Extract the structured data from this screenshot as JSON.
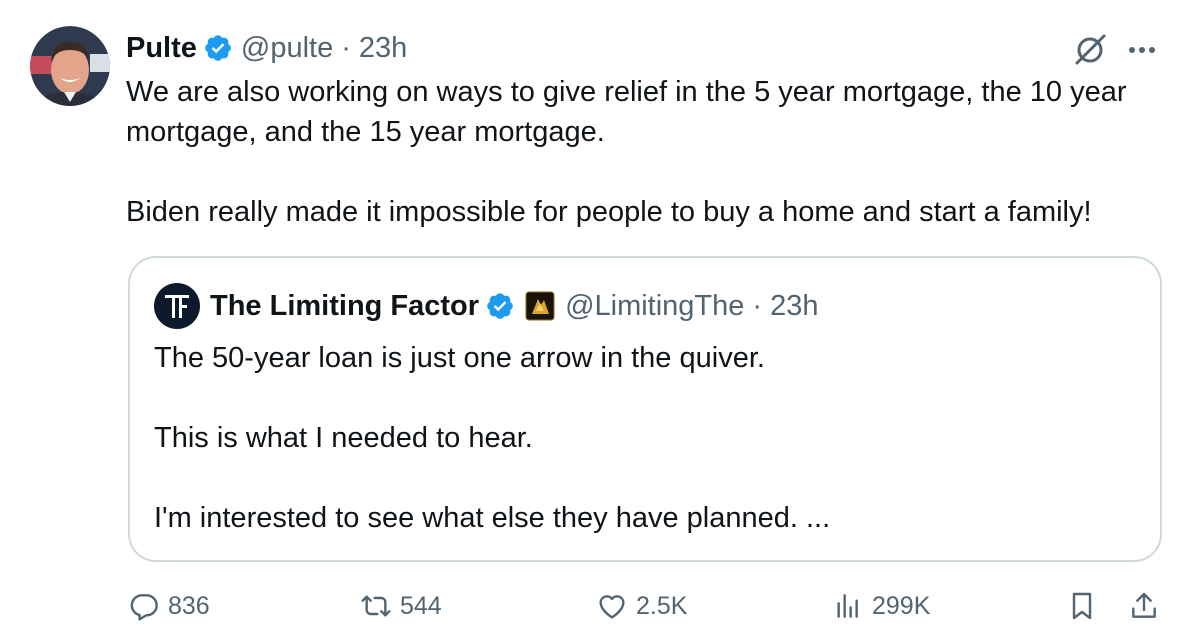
{
  "tweet": {
    "author": {
      "name": "Pulte",
      "handle": "@pulte",
      "time": "23h",
      "separator": "·"
    },
    "paragraphs": [
      "We are also working on ways to give relief in the 5 year mortgage, the 10 year mortgage, and the 15 year mortgage.",
      "Biden really made it impossible for people to buy a home and start a family!"
    ]
  },
  "quote": {
    "author": {
      "name": "The Limiting Factor",
      "handle": "@LimitingThe",
      "time": "23h",
      "separator": "·"
    },
    "paragraphs": [
      "The 50-year loan is just one arrow in the quiver.",
      "This is what I needed to hear.",
      "I'm interested to see what else they have planned. ..."
    ]
  },
  "actions": {
    "replies": "836",
    "reposts": "544",
    "likes": "2.5K",
    "views": "299K"
  },
  "icons": {
    "verified": "verified-badge-icon",
    "grok": "grok-icon",
    "more": "more-icon",
    "reply": "reply-icon",
    "repost": "repost-icon",
    "like": "heart-icon",
    "views": "views-icon",
    "bookmark": "bookmark-icon",
    "share": "share-icon"
  },
  "colors": {
    "verified": "#1d9bf0",
    "secondary_text": "#536471",
    "border": "#cfd9de"
  }
}
